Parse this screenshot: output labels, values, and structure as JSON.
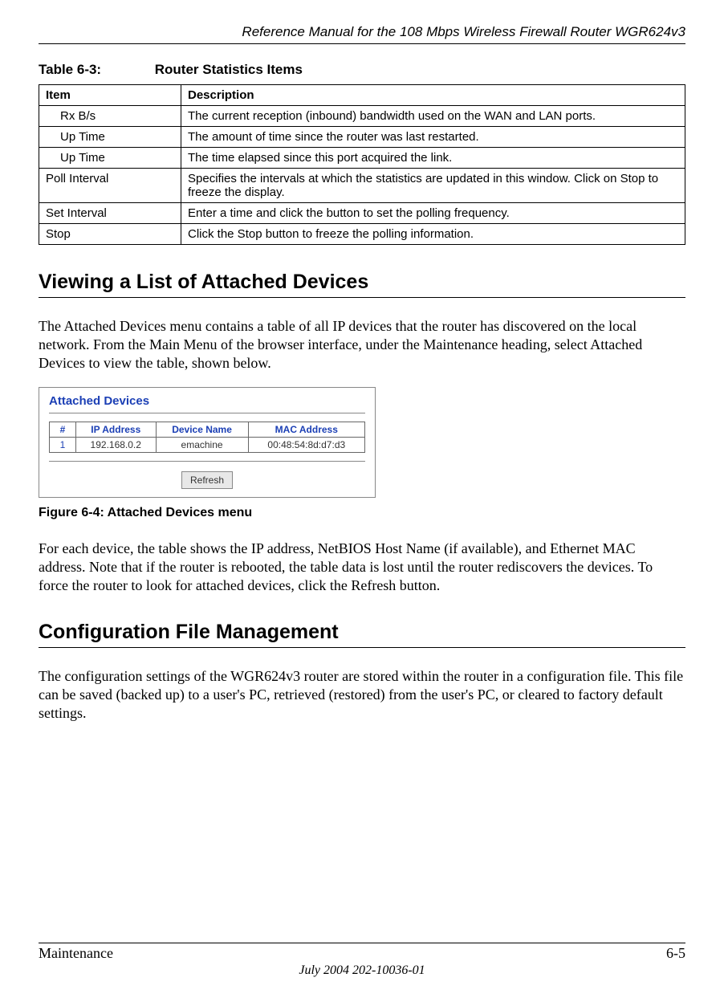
{
  "header": {
    "title": "Reference Manual for the 108 Mbps Wireless Firewall Router WGR624v3"
  },
  "table": {
    "caption_label": "Table 6-3:",
    "caption_title": "Router Statistics Items",
    "head_item": "Item",
    "head_desc": "Description",
    "rows": [
      {
        "item": "Rx B/s",
        "desc": "The current reception (inbound) bandwidth used on the WAN and LAN ports.",
        "indent": true,
        "group": "a"
      },
      {
        "item": "Up Time",
        "desc": "The amount of time since the router was last restarted.",
        "indent": true,
        "group": "a"
      },
      {
        "item": "Up Time",
        "desc": "The time elapsed since this port acquired the link.",
        "indent": true,
        "group": "a"
      },
      {
        "item": "Poll Interval",
        "desc": "Specifies the intervals at which the statistics are updated in this window. Click on Stop to freeze the display.",
        "indent": false,
        "group": "a"
      },
      {
        "item": "Set Interval",
        "desc": "Enter a time and click the button to set the polling frequency.",
        "indent": false,
        "group": "b"
      },
      {
        "item": "Stop",
        "desc": "Click the Stop button to freeze the polling information.",
        "indent": false,
        "group": "c"
      }
    ]
  },
  "section1": {
    "heading": "Viewing a List of Attached Devices",
    "para": "The Attached Devices menu contains a table of all IP devices that the router has discovered on the local network. From the Main Menu of the browser interface, under the Maintenance heading, select Attached Devices to view the table, shown below."
  },
  "figure": {
    "panel_title": "Attached Devices",
    "headers": [
      "#",
      "IP Address",
      "Device Name",
      "MAC Address"
    ],
    "row": [
      "1",
      "192.168.0.2",
      "emachine",
      "00:48:54:8d:d7:d3"
    ],
    "refresh_label": "Refresh",
    "caption": "Figure 6-4:  Attached Devices menu"
  },
  "para2": "For each device, the table shows the IP address, NetBIOS Host Name (if available), and Ethernet MAC address. Note that if the router is rebooted, the table data is lost until the router rediscovers the devices. To force the router to look for attached devices, click the Refresh button.",
  "section2": {
    "heading": "Configuration File Management",
    "para": "The configuration settings of the WGR624v3 router are stored within the router in a configuration file. This file can be saved (backed up) to a user's PC, retrieved (restored) from the user's PC, or cleared to factory default settings."
  },
  "footer": {
    "left": "Maintenance",
    "right": "6-5",
    "date": "July 2004 202-10036-01"
  }
}
